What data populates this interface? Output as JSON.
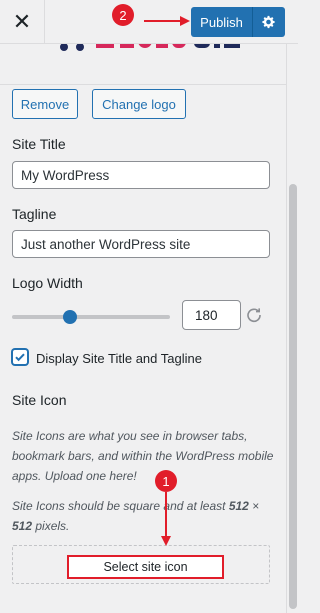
{
  "header": {
    "close_glyph": "✕",
    "publish_label": "Publish"
  },
  "logo": {
    "remove_label": "Remove",
    "change_label": "Change logo"
  },
  "site_title": {
    "label": "Site Title",
    "value": "My WordPress"
  },
  "tagline": {
    "label": "Tagline",
    "value": "Just another WordPress site"
  },
  "logo_width": {
    "label": "Logo Width",
    "value": "180",
    "slider_fraction": 0.37
  },
  "display_title": {
    "checked": true,
    "label": "Display Site Title and Tagline"
  },
  "site_icon": {
    "heading": "Site Icon",
    "desc1": "Site Icons are what you see in browser tabs, bookmark bars, and within the WordPress mobile apps. Upload one here!",
    "desc2_pre": "Site Icons should be square and at least ",
    "desc2_size_a": "512",
    "desc2_times": " × ",
    "desc2_size_b": "512",
    "desc2_post": " pixels.",
    "select_label": "Select site icon"
  },
  "annotations": {
    "badge1": "1",
    "badge2": "2"
  },
  "colors": {
    "accent": "#2271b1",
    "annotation": "#e11d2a"
  }
}
